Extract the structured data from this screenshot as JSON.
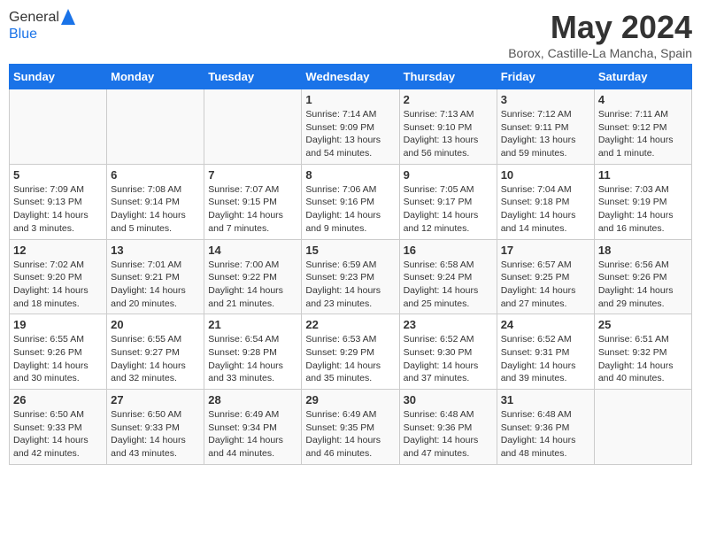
{
  "header": {
    "logo_line1": "General",
    "logo_line2": "Blue",
    "month_title": "May 2024",
    "location": "Borox, Castille-La Mancha, Spain"
  },
  "weekdays": [
    "Sunday",
    "Monday",
    "Tuesday",
    "Wednesday",
    "Thursday",
    "Friday",
    "Saturday"
  ],
  "weeks": [
    [
      {
        "day": "",
        "info": ""
      },
      {
        "day": "",
        "info": ""
      },
      {
        "day": "",
        "info": ""
      },
      {
        "day": "1",
        "info": "Sunrise: 7:14 AM\nSunset: 9:09 PM\nDaylight: 13 hours\nand 54 minutes."
      },
      {
        "day": "2",
        "info": "Sunrise: 7:13 AM\nSunset: 9:10 PM\nDaylight: 13 hours\nand 56 minutes."
      },
      {
        "day": "3",
        "info": "Sunrise: 7:12 AM\nSunset: 9:11 PM\nDaylight: 13 hours\nand 59 minutes."
      },
      {
        "day": "4",
        "info": "Sunrise: 7:11 AM\nSunset: 9:12 PM\nDaylight: 14 hours\nand 1 minute."
      }
    ],
    [
      {
        "day": "5",
        "info": "Sunrise: 7:09 AM\nSunset: 9:13 PM\nDaylight: 14 hours\nand 3 minutes."
      },
      {
        "day": "6",
        "info": "Sunrise: 7:08 AM\nSunset: 9:14 PM\nDaylight: 14 hours\nand 5 minutes."
      },
      {
        "day": "7",
        "info": "Sunrise: 7:07 AM\nSunset: 9:15 PM\nDaylight: 14 hours\nand 7 minutes."
      },
      {
        "day": "8",
        "info": "Sunrise: 7:06 AM\nSunset: 9:16 PM\nDaylight: 14 hours\nand 9 minutes."
      },
      {
        "day": "9",
        "info": "Sunrise: 7:05 AM\nSunset: 9:17 PM\nDaylight: 14 hours\nand 12 minutes."
      },
      {
        "day": "10",
        "info": "Sunrise: 7:04 AM\nSunset: 9:18 PM\nDaylight: 14 hours\nand 14 minutes."
      },
      {
        "day": "11",
        "info": "Sunrise: 7:03 AM\nSunset: 9:19 PM\nDaylight: 14 hours\nand 16 minutes."
      }
    ],
    [
      {
        "day": "12",
        "info": "Sunrise: 7:02 AM\nSunset: 9:20 PM\nDaylight: 14 hours\nand 18 minutes."
      },
      {
        "day": "13",
        "info": "Sunrise: 7:01 AM\nSunset: 9:21 PM\nDaylight: 14 hours\nand 20 minutes."
      },
      {
        "day": "14",
        "info": "Sunrise: 7:00 AM\nSunset: 9:22 PM\nDaylight: 14 hours\nand 21 minutes."
      },
      {
        "day": "15",
        "info": "Sunrise: 6:59 AM\nSunset: 9:23 PM\nDaylight: 14 hours\nand 23 minutes."
      },
      {
        "day": "16",
        "info": "Sunrise: 6:58 AM\nSunset: 9:24 PM\nDaylight: 14 hours\nand 25 minutes."
      },
      {
        "day": "17",
        "info": "Sunrise: 6:57 AM\nSunset: 9:25 PM\nDaylight: 14 hours\nand 27 minutes."
      },
      {
        "day": "18",
        "info": "Sunrise: 6:56 AM\nSunset: 9:26 PM\nDaylight: 14 hours\nand 29 minutes."
      }
    ],
    [
      {
        "day": "19",
        "info": "Sunrise: 6:55 AM\nSunset: 9:26 PM\nDaylight: 14 hours\nand 30 minutes."
      },
      {
        "day": "20",
        "info": "Sunrise: 6:55 AM\nSunset: 9:27 PM\nDaylight: 14 hours\nand 32 minutes."
      },
      {
        "day": "21",
        "info": "Sunrise: 6:54 AM\nSunset: 9:28 PM\nDaylight: 14 hours\nand 33 minutes."
      },
      {
        "day": "22",
        "info": "Sunrise: 6:53 AM\nSunset: 9:29 PM\nDaylight: 14 hours\nand 35 minutes."
      },
      {
        "day": "23",
        "info": "Sunrise: 6:52 AM\nSunset: 9:30 PM\nDaylight: 14 hours\nand 37 minutes."
      },
      {
        "day": "24",
        "info": "Sunrise: 6:52 AM\nSunset: 9:31 PM\nDaylight: 14 hours\nand 39 minutes."
      },
      {
        "day": "25",
        "info": "Sunrise: 6:51 AM\nSunset: 9:32 PM\nDaylight: 14 hours\nand 40 minutes."
      }
    ],
    [
      {
        "day": "26",
        "info": "Sunrise: 6:50 AM\nSunset: 9:33 PM\nDaylight: 14 hours\nand 42 minutes."
      },
      {
        "day": "27",
        "info": "Sunrise: 6:50 AM\nSunset: 9:33 PM\nDaylight: 14 hours\nand 43 minutes."
      },
      {
        "day": "28",
        "info": "Sunrise: 6:49 AM\nSunset: 9:34 PM\nDaylight: 14 hours\nand 44 minutes."
      },
      {
        "day": "29",
        "info": "Sunrise: 6:49 AM\nSunset: 9:35 PM\nDaylight: 14 hours\nand 46 minutes."
      },
      {
        "day": "30",
        "info": "Sunrise: 6:48 AM\nSunset: 9:36 PM\nDaylight: 14 hours\nand 47 minutes."
      },
      {
        "day": "31",
        "info": "Sunrise: 6:48 AM\nSunset: 9:36 PM\nDaylight: 14 hours\nand 48 minutes."
      },
      {
        "day": "",
        "info": ""
      }
    ]
  ]
}
